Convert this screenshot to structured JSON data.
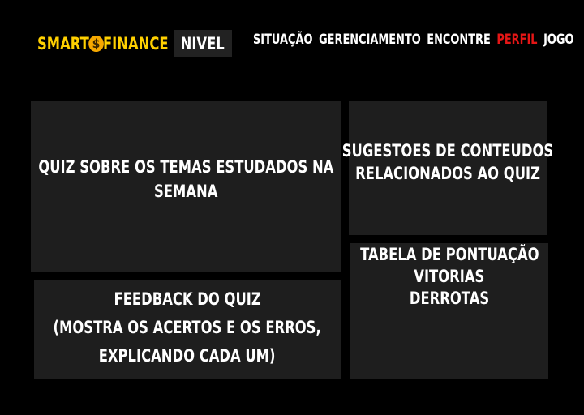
{
  "header": {
    "logo": {
      "part1": "SMART",
      "coin_symbol": "$",
      "part2": "FINANCE",
      "color": "#ffd000",
      "coin_color": "#f5a800"
    },
    "level_button": "NIVEL",
    "nav": {
      "items": [
        {
          "label": "SITUAÇÃO"
        },
        {
          "label": "GERENCIAMENTO"
        },
        {
          "label": "ENCONTRE"
        },
        {
          "label": "PERFIL",
          "active": true
        },
        {
          "label": "JOGO"
        }
      ],
      "active_color": "#e51616"
    }
  },
  "panels": {
    "quiz": {
      "lines": [
        "QUIZ SOBRE OS TEMAS ESTUDADOS NA",
        "SEMANA"
      ]
    },
    "suggestions": {
      "lines": [
        "SUGESTOES DE CONTEUDOS",
        "RELACIONADOS AO QUIZ"
      ]
    },
    "feedback": {
      "lines": [
        "FEEDBACK DO QUIZ",
        "(MOSTRA OS ACERTOS E OS ERROS,",
        "EXPLICANDO CADA UM)"
      ]
    },
    "score_table": {
      "lines": [
        "TABELA DE PONTUAÇÃO",
        "VITORIAS",
        "DERROTAS"
      ]
    }
  },
  "colors": {
    "background": "#000000",
    "panel": "#1e1e1e",
    "level_button_bg": "#222222"
  }
}
